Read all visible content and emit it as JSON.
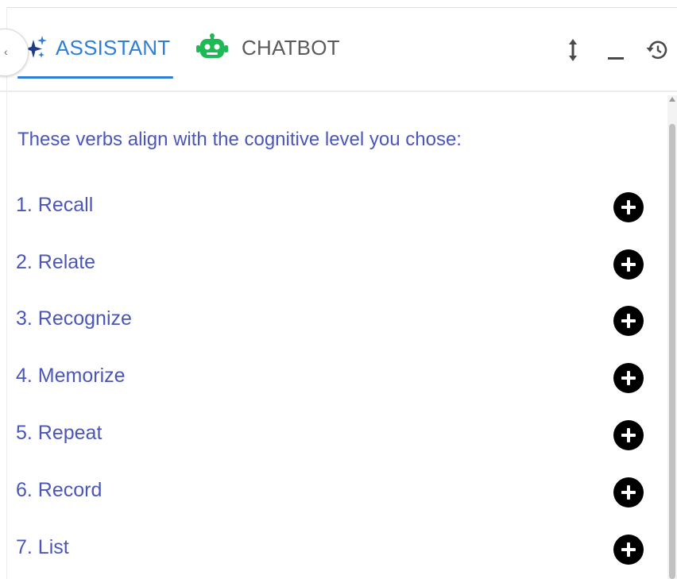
{
  "header": {
    "tabs": [
      {
        "id": "assistant",
        "label": "ASSISTANT",
        "active": true,
        "icon": "sparkles-icon"
      },
      {
        "id": "chatbot",
        "label": "CHATBOT",
        "active": false,
        "icon": "robot-icon"
      }
    ],
    "actions": [
      "resize-vertical-icon",
      "minimize-icon",
      "history-icon"
    ]
  },
  "content": {
    "intro": "These verbs align with the cognitive level you chose:",
    "verbs": [
      "1. Recall",
      "2. Relate",
      "3. Recognize",
      "4. Memorize",
      "5. Repeat",
      "6. Record",
      "7. List"
    ]
  },
  "colors": {
    "accent": "#2f7fd6",
    "text": "#4b56b8",
    "robot": "#1db954"
  }
}
